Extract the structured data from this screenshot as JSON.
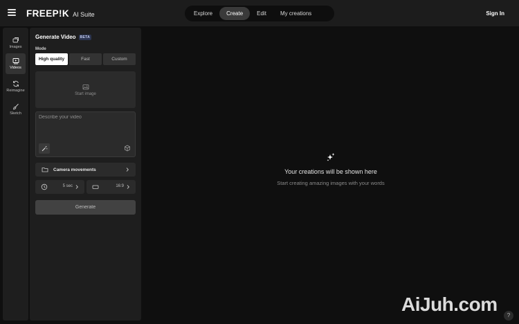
{
  "header": {
    "brand": "FREEP!K",
    "suite": "AI Suite",
    "nav": [
      "Explore",
      "Create",
      "Edit",
      "My creations"
    ],
    "active_nav": "Create",
    "signin": "Sign In",
    "menu_icon": "hamburger-menu-icon"
  },
  "rail": {
    "items": [
      {
        "label": "Images",
        "icon": "images-icon"
      },
      {
        "label": "Videos",
        "icon": "video-icon"
      },
      {
        "label": "Reimagine",
        "icon": "refresh-icon"
      },
      {
        "label": "Sketch",
        "icon": "brush-icon"
      }
    ],
    "active": "Videos"
  },
  "panel": {
    "title": "Generate Video",
    "badge": "BETA",
    "mode_label": "Mode",
    "modes": [
      "High quality",
      "Fast",
      "Custom"
    ],
    "active_mode": "High quality",
    "start_image_label": "Start image",
    "prompt_placeholder": "Describe your video",
    "camera_label": "Camera movements",
    "duration": "5 sec",
    "aspect": "16:9",
    "generate_label": "Generate"
  },
  "main": {
    "empty_title": "Your creations will be shown here",
    "empty_subtitle": "Start creating amazing images with your words"
  },
  "watermark": "AiJuh.com",
  "help_label": "?"
}
